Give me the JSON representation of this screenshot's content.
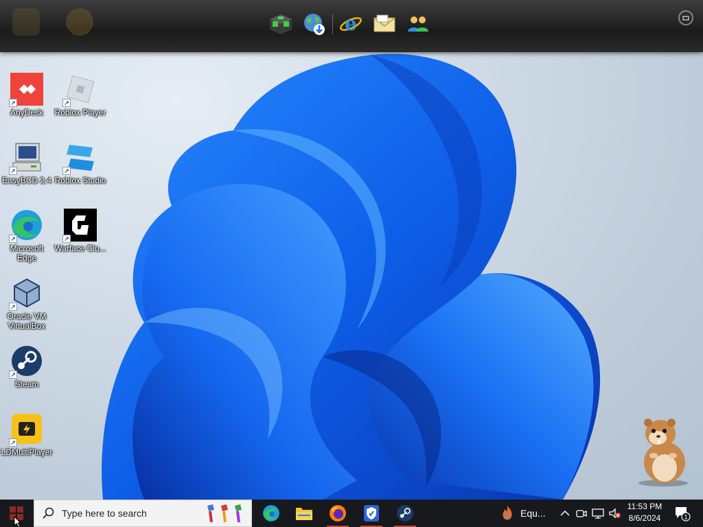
{
  "dock": {
    "items": [
      {
        "name": "dock-item-minecraft",
        "icon": "cube-grid-icon"
      },
      {
        "name": "dock-item-globe-download",
        "icon": "globe-download-icon"
      },
      {
        "name": "dock-item-internet-explorer",
        "icon": "internet-explorer-icon"
      },
      {
        "name": "dock-item-mail",
        "icon": "envelope-icon"
      },
      {
        "name": "dock-item-people",
        "icon": "people-icon"
      }
    ]
  },
  "desktop": {
    "icons": [
      {
        "label": "AnyDesk",
        "icon": "anydesk-icon"
      },
      {
        "label": "Roblox Player",
        "icon": "roblox-player-icon"
      },
      {
        "label": "EasyBCD 2.4",
        "icon": "easybcd-icon"
      },
      {
        "label": "Roblox Studio",
        "icon": "roblox-studio-icon"
      },
      {
        "label": "Microsoft Edge",
        "icon": "edge-icon"
      },
      {
        "label": "Warface Clu...",
        "icon": "warface-icon"
      },
      {
        "label": "Oracle VM VirtualBox",
        "icon": "virtualbox-icon"
      },
      {
        "label": "Steam",
        "icon": "steam-icon"
      },
      {
        "label": "LDMultiPlayer",
        "icon": "ldmultiplayer-icon"
      }
    ]
  },
  "taskbar": {
    "search_placeholder": "Type here to search",
    "apps": [
      {
        "name": "edge",
        "icon": "edge-icon"
      },
      {
        "name": "file-explorer",
        "icon": "folder-icon"
      },
      {
        "name": "firefox",
        "icon": "firefox-icon"
      },
      {
        "name": "security",
        "icon": "shield-icon"
      },
      {
        "name": "steam",
        "icon": "steam-icon"
      }
    ],
    "running_app_label": "Equ...",
    "clock": {
      "time": "11:53 PM",
      "date": "8/6/2024"
    },
    "notification_count": "1"
  },
  "colors": {
    "accent": "#1a6ff0",
    "taskbar": "#17191d",
    "running_indicator": "#b54a3a"
  }
}
